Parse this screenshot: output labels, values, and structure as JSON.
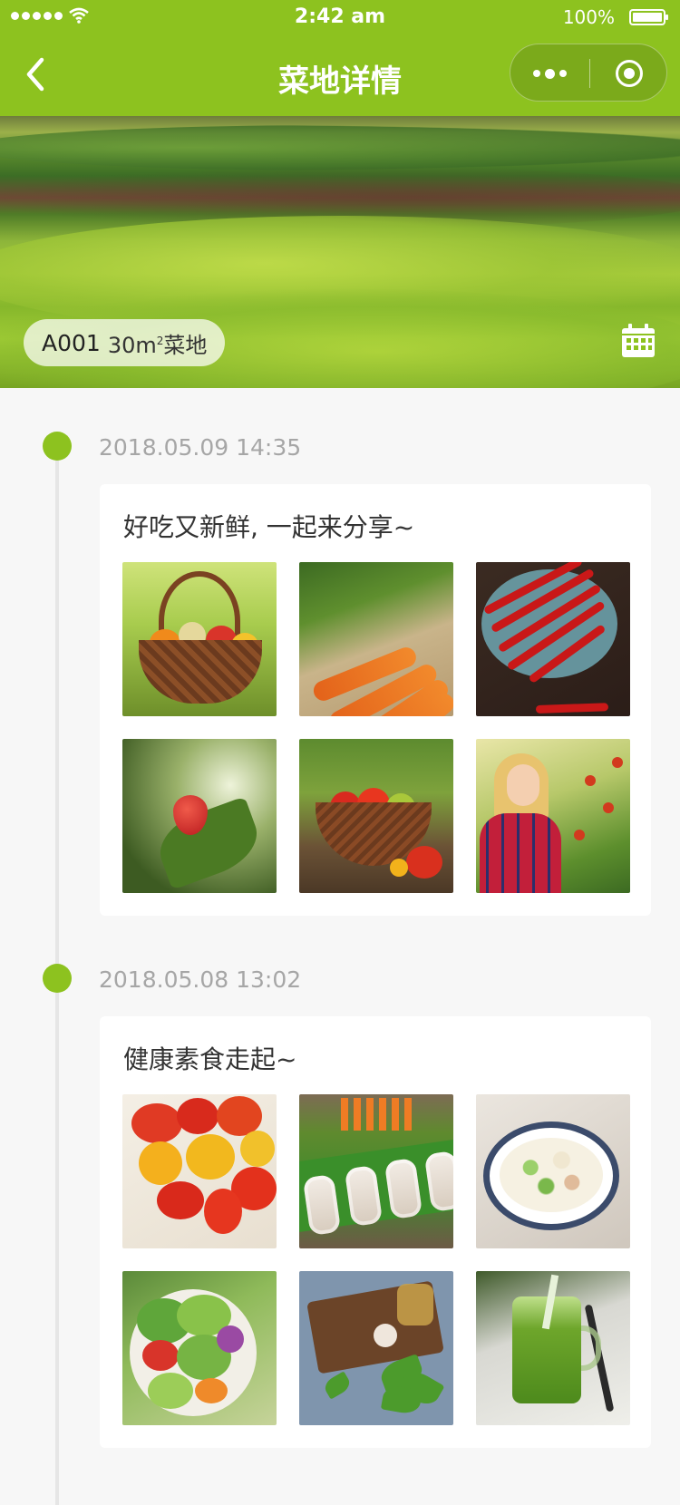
{
  "status_bar": {
    "time": "2:42 am",
    "battery": "100%"
  },
  "nav": {
    "title": "菜地详情"
  },
  "plot": {
    "code": "A001",
    "size": "30m",
    "unit_sup": "2",
    "type": "菜地"
  },
  "posts": [
    {
      "date": "2018.05.09 14:35",
      "text": "好吃又新鲜, 一起来分享~",
      "photos": [
        "vegetable-basket",
        "carrots",
        "red-chili-peppers",
        "strawberry",
        "tomato-basket",
        "woman-in-garden"
      ]
    },
    {
      "date": "2018.05.08 13:02",
      "text": "健康素食走起~",
      "photos": [
        "cherry-tomato-plate",
        "spring-rolls",
        "potato-salad-bowl",
        "green-salad",
        "basil-cutting-board",
        "green-juice-jar"
      ]
    }
  ],
  "colors": {
    "primary": "#8dc21f",
    "page_bg": "#f7f7f7",
    "date_text": "#a6a6a6",
    "body_text": "#333333"
  }
}
